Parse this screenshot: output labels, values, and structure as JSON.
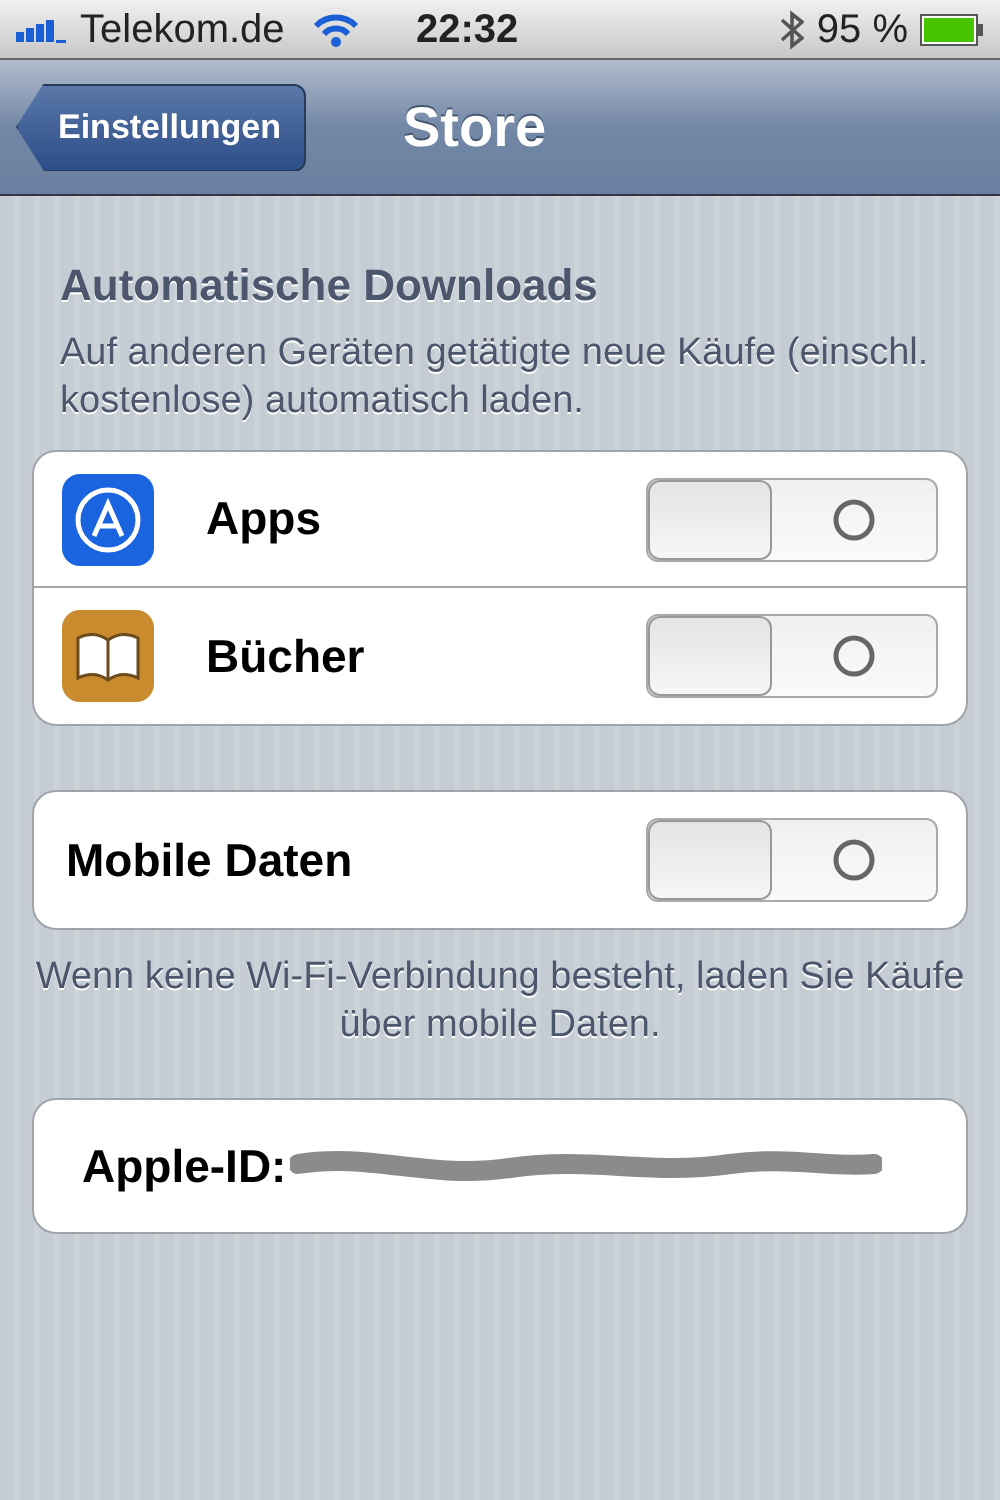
{
  "status_bar": {
    "carrier": "Telekom.de",
    "time": "22:32",
    "battery": "95 %"
  },
  "nav": {
    "back": "Einstellungen",
    "title": "Store"
  },
  "section": {
    "title": "Automatische Downloads",
    "description": "Auf anderen Geräten getätigte neue Käufe (einschl. kostenlose) automatisch laden."
  },
  "downloads": [
    {
      "label": "Apps",
      "kind": "appstore",
      "on": false
    },
    {
      "label": "Bücher",
      "kind": "books",
      "on": false
    }
  ],
  "mobile": {
    "label": "Mobile Daten",
    "on": false
  },
  "mobile_note": "Wenn keine Wi-Fi-Verbindung besteht, laden Sie Käufe über mobile Daten.",
  "account": {
    "label": "Apple-ID:"
  }
}
